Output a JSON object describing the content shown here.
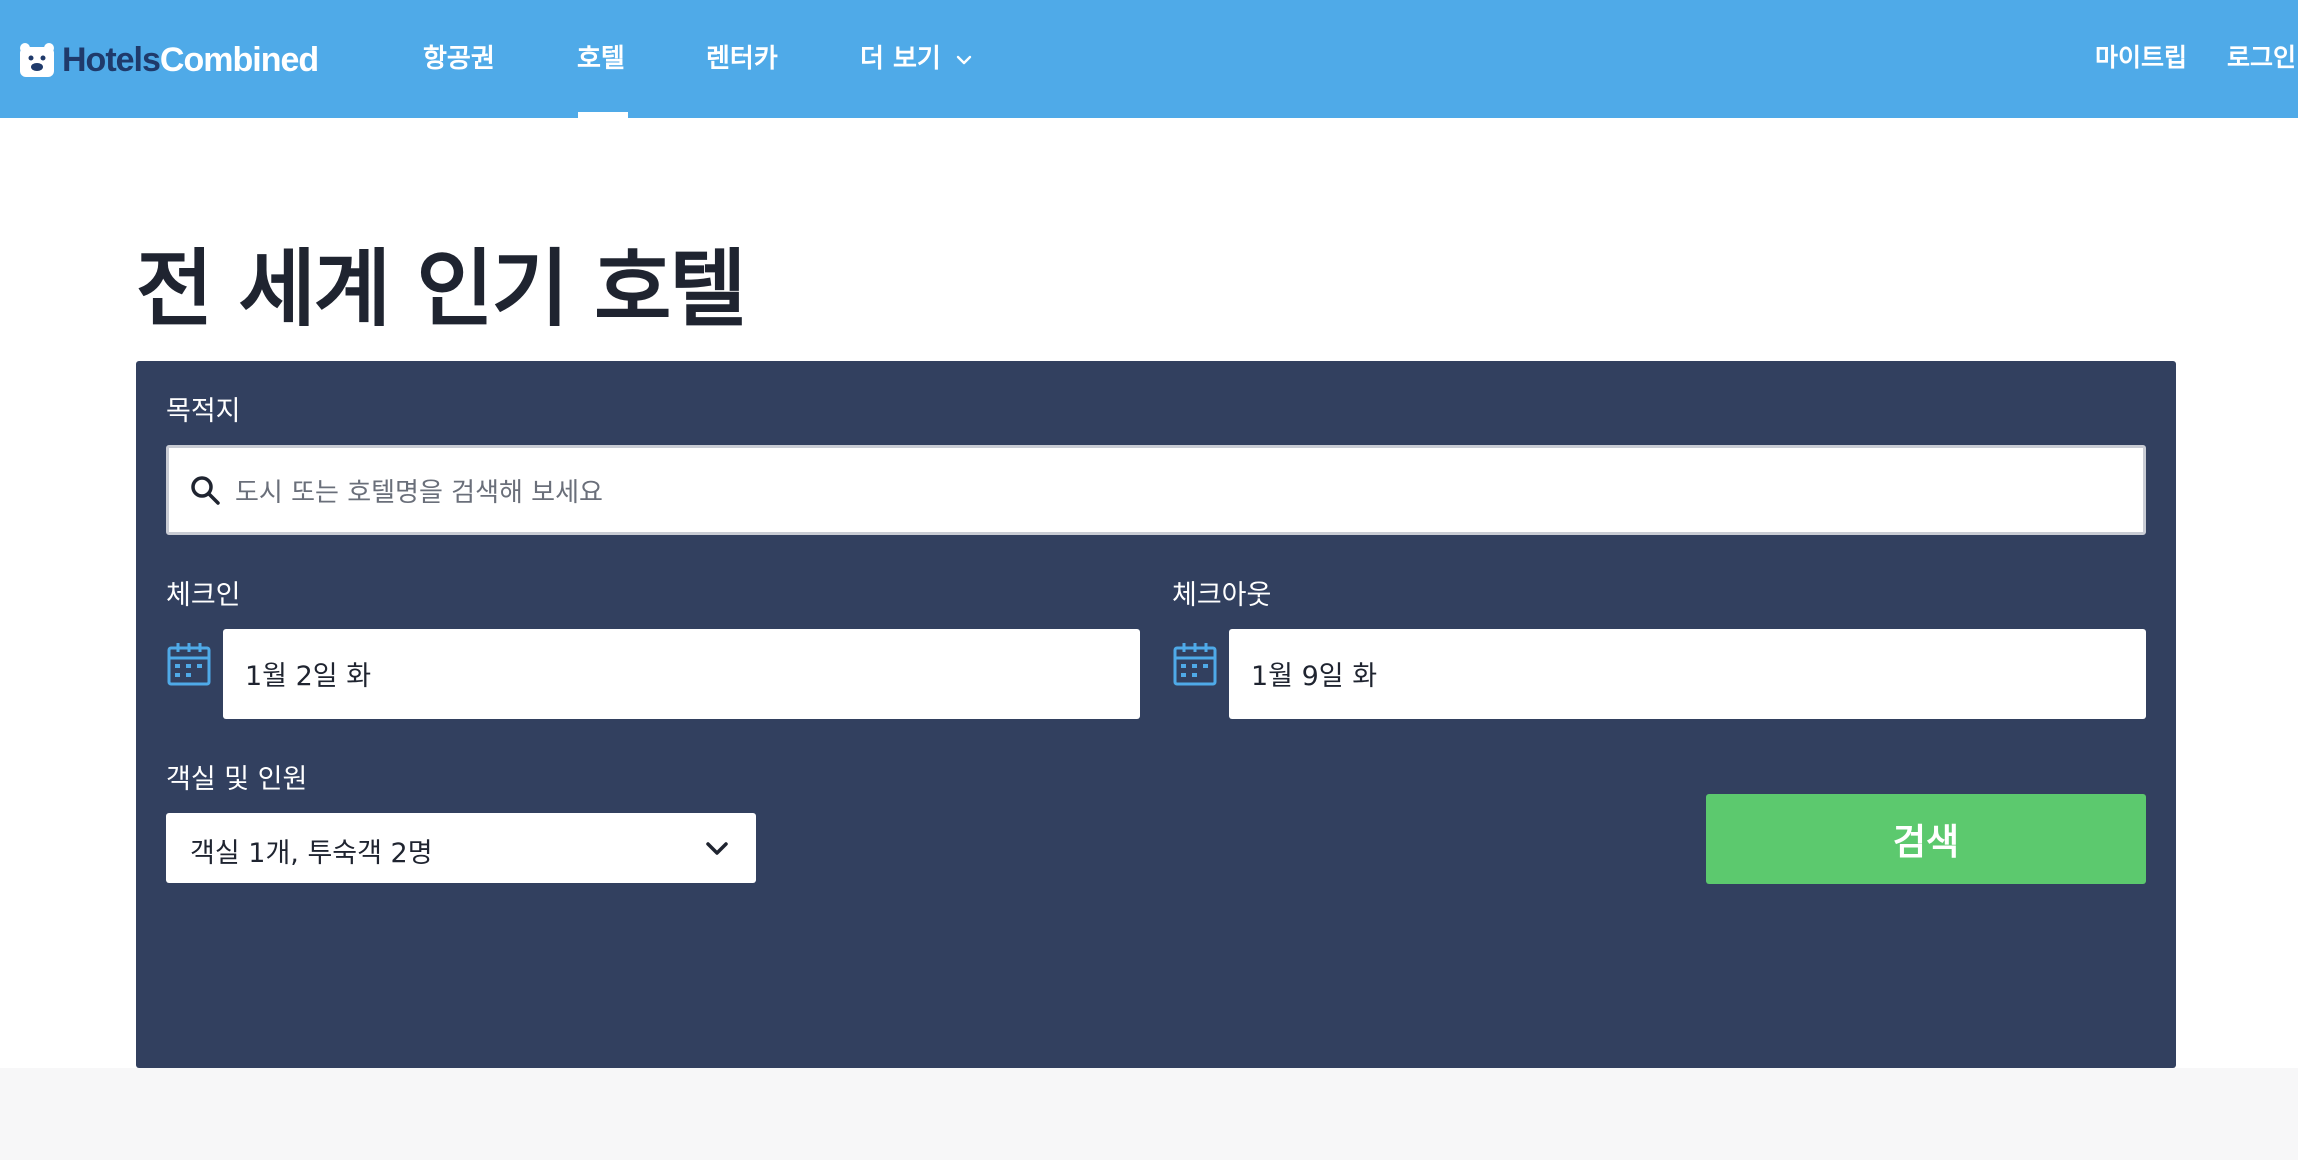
{
  "header": {
    "logo_text_a": "Hotels",
    "logo_text_b": "Combined",
    "nav": [
      {
        "label": "항공권"
      },
      {
        "label": "호텔"
      },
      {
        "label": "렌터카"
      },
      {
        "label": "더 보기"
      }
    ],
    "right": [
      {
        "label": "마이트립"
      },
      {
        "label": "로그인"
      }
    ]
  },
  "main": {
    "title": "전 세계 인기 호텔",
    "destination": {
      "label": "목적지",
      "placeholder": "도시 또는 호텔명을 검색해 보세요"
    },
    "checkin": {
      "label": "체크인",
      "value": "1월 2일 화"
    },
    "checkout": {
      "label": "체크아웃",
      "value": "1월 9일 화"
    },
    "rooms": {
      "label": "객실 및 인원",
      "value": "객실 1개, 투숙객 2명"
    },
    "search_button": "검색"
  },
  "colors": {
    "header_bg": "#4faae8",
    "panel_bg": "#32405f",
    "search_button_bg": "#5cc96e"
  }
}
